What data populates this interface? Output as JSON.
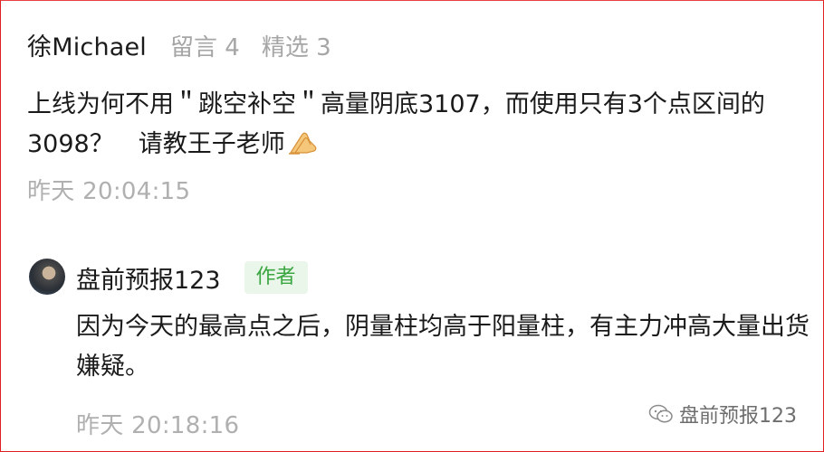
{
  "comment": {
    "username": "徐Michael",
    "likes_label": "留言 4",
    "selected_label": "精选 3",
    "text": "上线为何不用＂跳空补空＂高量阴底3107，而使用只有3个点区间的3098？　请教王子老师",
    "emoji_icon": "praying-hands-icon",
    "timestamp": "昨天 20:04:15"
  },
  "reply": {
    "author": "盘前预报123",
    "tag": "作者",
    "text": "因为今天的最高点之后，阴量柱均高于阳量柱，有主力冲高大量出货嫌疑。",
    "timestamp": "昨天 20:18:16"
  },
  "watermark": {
    "text": "盘前预报123",
    "icon": "wechat-icon"
  },
  "colors": {
    "border": "#e02020",
    "tag_bg": "#eaf6ea",
    "tag_text": "#3aa640",
    "muted": "#b0b0b0"
  }
}
